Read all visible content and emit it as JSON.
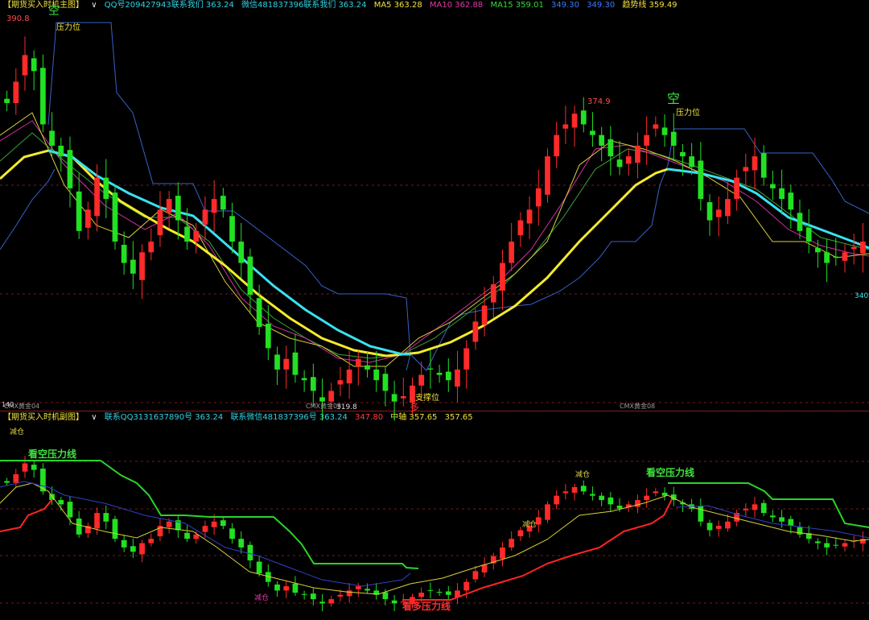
{
  "header_main": {
    "title": "【期货买入时机主图】",
    "chevron": "∨",
    "qq": "QQ号209427943联系我们 363.24",
    "wechat": "微信481837396联系我们 363.24",
    "ma5": "MA5 363.28",
    "ma10": "MA10 362.88",
    "ma15": "MA15 359.01",
    "v1": "349.30",
    "v2": "349.30",
    "trend": "趋势线 359.49"
  },
  "header_sub": {
    "title": "【期货买入时机副图】",
    "chevron": "∨",
    "qq": "联系QQ3131637890号 363.24",
    "wechat": "联系微信481837396号 363.24",
    "v347": "347.80",
    "mid": "中轴 357.65",
    "mid2": "357.65"
  },
  "main_labels": {
    "high": "390.8",
    "kong_left": "空",
    "pressure_left": "压力位",
    "high2": "374.9",
    "kong_right": "空",
    "pressure_right": "压力位",
    "support": "支撑位",
    "duo": "多",
    "low": "319.8",
    "right_value": "340",
    "month_left": "CMX黄金04",
    "month_mid": "CMX黄金06",
    "month_right": "CMX黄金08",
    "axis_bottom": "140"
  },
  "sub_labels": {
    "jiancang1": "减仓",
    "kankong1": "看空压力线",
    "jiancang2": "减仓",
    "jiancang3": "减仓",
    "kankong2": "看空压力线",
    "jiancang4": "减仓",
    "kanduo": "看多压力线"
  },
  "colors": {
    "background": "#000000",
    "bull": "#ff2a2a",
    "bear": "#22e022",
    "cyan": "#39e1f0",
    "yellow": "#f4ea2c",
    "magenta": "#d12ea3",
    "ma_green": "#3aa63a",
    "channel": "#3563c9",
    "grid": "#7a1818"
  },
  "chart_data": {
    "type": "candlestick",
    "instrument": "CMX黄金",
    "main": {
      "ma5": 363.28,
      "ma10": 362.88,
      "ma15": 359.01,
      "trend": 359.49,
      "upper_band": 349.3,
      "lower_band": 349.3,
      "high_marker": 390.8,
      "peak_marker": 374.9,
      "low_marker": 319.8
    },
    "sub": {
      "mid_axis": 357.65,
      "value": 347.8
    },
    "close_path": [
      376,
      380,
      385,
      382,
      372,
      368,
      366,
      360,
      352,
      356,
      362,
      358,
      350,
      346,
      344,
      348,
      350,
      356,
      358,
      354,
      350,
      352,
      356,
      358,
      356,
      350,
      346,
      340,
      334,
      330,
      326,
      328,
      325,
      324,
      322,
      320,
      322,
      324,
      326,
      328,
      326,
      324,
      322,
      320,
      321,
      323,
      325,
      326,
      325,
      324,
      326,
      330,
      335,
      338,
      342,
      346,
      350,
      354,
      356,
      360,
      366,
      370,
      372,
      374,
      372,
      370,
      368,
      366,
      364,
      366,
      368,
      370,
      372,
      370,
      368,
      366,
      364,
      358,
      354,
      356,
      358,
      362,
      364,
      366,
      362,
      360,
      358,
      356,
      352,
      350,
      348,
      346,
      347,
      348,
      349,
      350
    ]
  }
}
